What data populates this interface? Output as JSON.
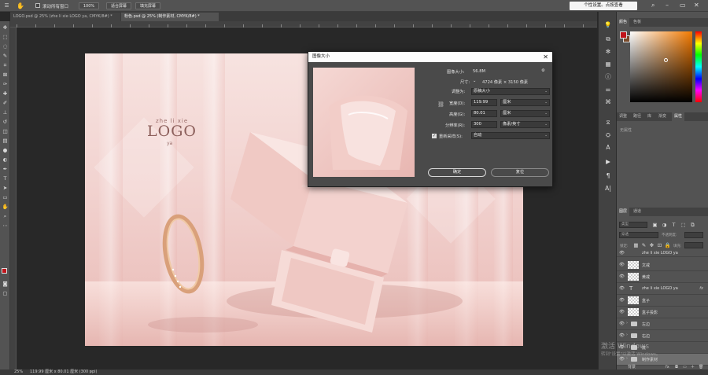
{
  "options_bar": {
    "scroll_all_label": "滚动所有窗口",
    "zoom_value": "100%",
    "fit_screen_label": "适合屏幕",
    "fill_screen_label": "填充屏幕",
    "tooltip": "个性设置。点按查看"
  },
  "tabs": [
    {
      "label": "LOGO.psd @ 25% (zhe li xie LOGO ya, CMYK/8#) *",
      "active": false
    },
    {
      "label": "粉色.psd @ 25% (制作素材, CMYK/8#) *",
      "active": true
    }
  ],
  "artwork": {
    "logo_top": "zhe li xie",
    "logo_main": "LOGO",
    "logo_sub": "ya",
    "box_engrave": "zhe li xie LOGO ya"
  },
  "status": {
    "zoom": "25%",
    "doc_info": "119.99 厘米 x 80.01 厘米 (300 ppi)"
  },
  "color_panel": {
    "tabs": [
      "颜色",
      "色板"
    ],
    "fg_color": "#c0141b",
    "bg_color": "#7a4a2a"
  },
  "props_panel": {
    "tabs": [
      "调整",
      "路径",
      "库",
      "渐变",
      "属性"
    ],
    "empty_text": "无属性"
  },
  "layers_panel": {
    "tabs": [
      "图层",
      "通道"
    ],
    "kind_placeholder": "类型",
    "blend_mode": "穿透",
    "opacity_label": "不透明度:",
    "lock_label": "锁定:",
    "fill_label": "填充:",
    "layers": [
      {
        "name": "zhe li xie LOGO ya",
        "type": "text",
        "partial": true
      },
      {
        "name": "文戒",
        "type": "pixel"
      },
      {
        "name": "黄戒",
        "type": "pixel"
      },
      {
        "name": "zhe li xie LOGO ya",
        "type": "text",
        "fx": "fx"
      },
      {
        "name": "盒子",
        "type": "pixel"
      },
      {
        "name": "盒子投影",
        "type": "pixel"
      },
      {
        "name": "左边",
        "type": "group"
      },
      {
        "name": "右边",
        "type": "group"
      },
      {
        "name": "底",
        "type": "group"
      },
      {
        "name": "制作素材",
        "type": "group",
        "selected": true
      },
      {
        "name": "背景",
        "type": "pixel"
      }
    ]
  },
  "dialog": {
    "title": "图像大小",
    "image_size_label": "图像大小:",
    "image_size_value": "56.8M",
    "dimensions_label": "尺寸:",
    "dimensions_value": "4724 像素 × 3150 像素",
    "fit_label": "调整为:",
    "fit_value": "原稿大小",
    "width_label": "宽度(D):",
    "width_value": "119.99",
    "width_unit": "厘米",
    "height_label": "高度(G):",
    "height_value": "80.01",
    "height_unit": "厘米",
    "resolution_label": "分辨率(R):",
    "resolution_value": "300",
    "resolution_unit": "像素/英寸",
    "resample_label": "重新采样(S):",
    "resample_checked": true,
    "resample_value": "自动",
    "ok_label": "确定",
    "reset_label": "复位"
  },
  "watermark": {
    "line1": "激活 Windows",
    "line2": "转到\"设置\"以激活 Windows。"
  }
}
